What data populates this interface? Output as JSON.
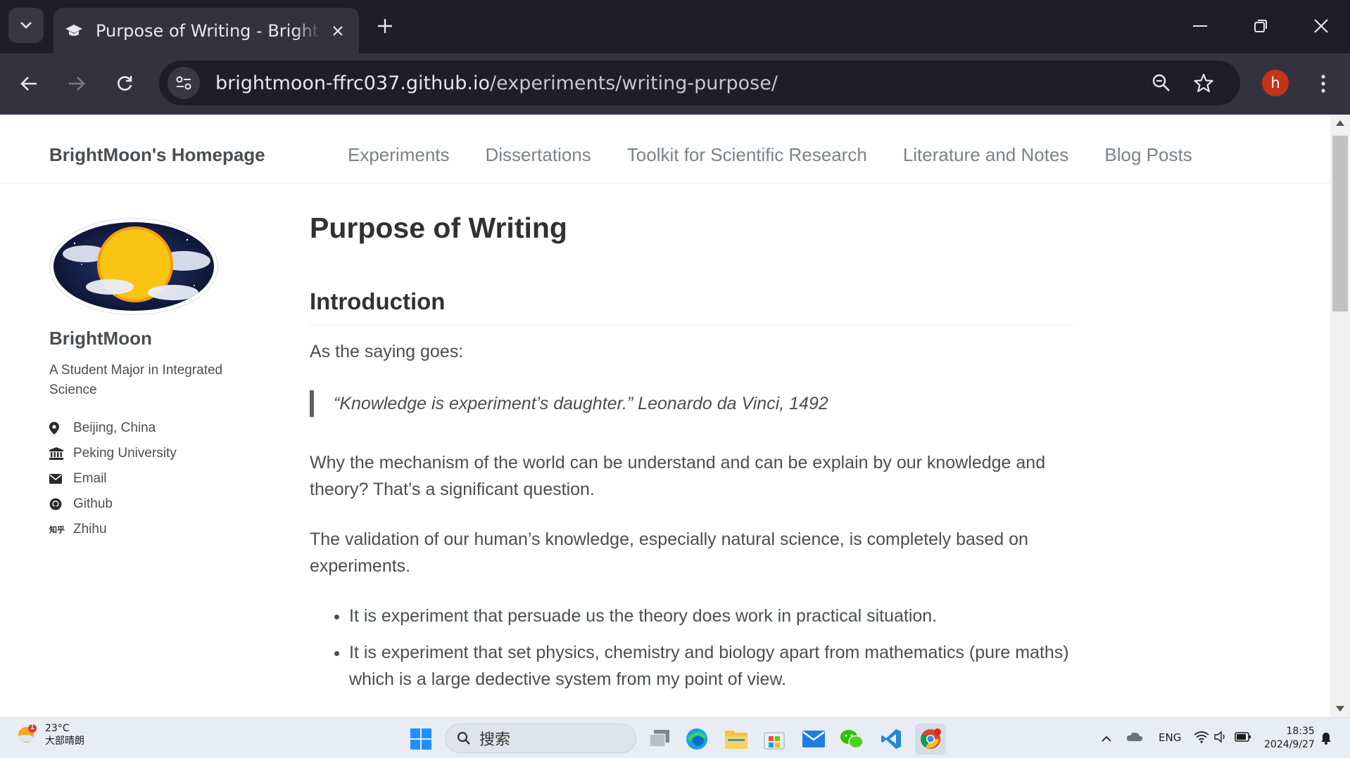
{
  "browser": {
    "tab_title": "Purpose of Writing - BrightMoon's Homepage",
    "url_host": "brightmoon-ffrc037.github.io",
    "url_path": "/experiments/writing-purpose/",
    "profile_initial": "h"
  },
  "site": {
    "title": "BrightMoon's Homepage",
    "nav": [
      "Experiments",
      "Dissertations",
      "Toolkit for Scientific Research",
      "Literature and Notes",
      "Blog Posts"
    ]
  },
  "sidebar": {
    "name": "BrightMoon",
    "bio": "A Student Major in Integrated Science",
    "links": [
      {
        "icon": "map-marker-icon",
        "label": "Beijing, China"
      },
      {
        "icon": "university-icon",
        "label": "Peking University"
      },
      {
        "icon": "envelope-icon",
        "label": "Email"
      },
      {
        "icon": "github-icon",
        "label": "Github"
      },
      {
        "icon": "zhihu-icon",
        "label": "Zhihu",
        "icon_text": "知乎"
      }
    ]
  },
  "article": {
    "title": "Purpose of Writing",
    "section_heading": "Introduction",
    "p1": "As the saying goes:",
    "quote": "“Knowledge is experiment’s daughter.” Leonardo da Vinci, 1492",
    "p2": "Why the mechanism of the world can be understand and can be explain by our knowledge and theory? That’s a significant question.",
    "p3": "The validation of our human’s knowledge, especially natural science, is completely based on experiments.",
    "bullets": [
      "It is experiment that persuade us the theory does work in practical situation.",
      "It is experiment that set physics, chemistry and biology apart from mathematics (pure maths) which is a large dedective system from my point of view."
    ]
  },
  "taskbar": {
    "weather_temp": "23°C",
    "weather_desc": "大部晴朗",
    "weather_badge": "1",
    "search_placeholder": "搜索",
    "lang": "ENG",
    "time": "18:35",
    "date": "2024/9/27"
  },
  "colors": {
    "titlebar": "#1f1d2a",
    "toolbar": "#35323f",
    "text": "#494e52",
    "heading": "#313131",
    "nav": "#7a8288",
    "profile": "#c4331a"
  }
}
